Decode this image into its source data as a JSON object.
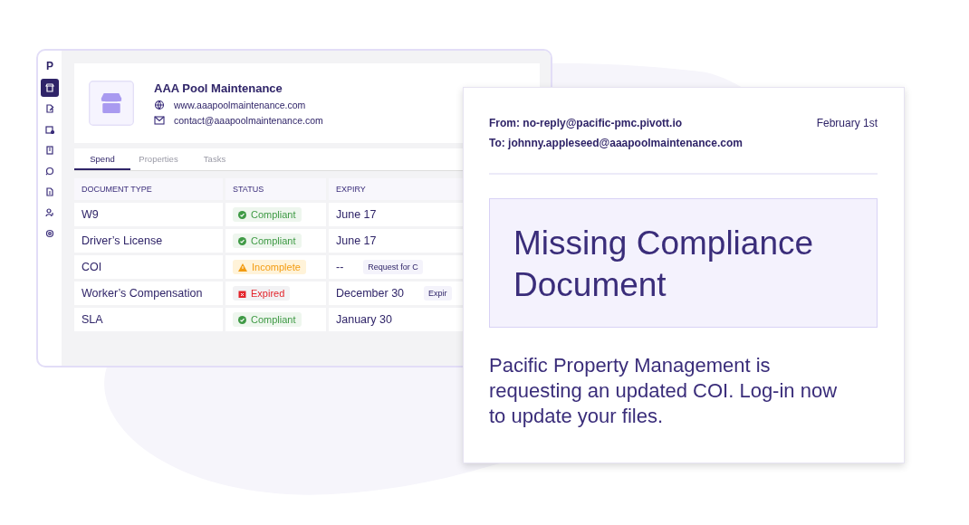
{
  "app": {
    "logo": "P",
    "sidebar": [
      {
        "selected": true
      },
      {
        "selected": false
      },
      {
        "selected": false
      },
      {
        "selected": false
      },
      {
        "selected": false
      },
      {
        "selected": false
      },
      {
        "selected": false
      },
      {
        "selected": false
      }
    ],
    "vendor": {
      "name": "AAA Pool Maintenance",
      "website": "www.aaapoolmaintenance.com",
      "email": "contact@aaapoolmaintenance.com"
    },
    "tabs": [
      {
        "label": "Spend",
        "selected": true
      },
      {
        "label": "Properties",
        "selected": false
      },
      {
        "label": "Tasks",
        "selected": false
      }
    ],
    "table": {
      "columns": [
        "DOCUMENT TYPE",
        "STATUS",
        "EXPIRY"
      ],
      "rows": [
        {
          "document_type": "W9",
          "status": "Compliant",
          "kind": "compliant",
          "expiry": "June 17"
        },
        {
          "document_type": "Driver’s License",
          "status": "Compliant",
          "kind": "compliant",
          "expiry": "June 17"
        },
        {
          "document_type": "COI",
          "status": "Incomplete",
          "kind": "incomplete",
          "expiry": "--",
          "action": "Request for C"
        },
        {
          "document_type": "Worker’s Compensation",
          "status": "Expired",
          "kind": "expired",
          "expiry": "December 30",
          "action": "Expir"
        },
        {
          "document_type": "SLA",
          "status": "Compliant",
          "kind": "compliant",
          "expiry": "January 30"
        }
      ]
    }
  },
  "email": {
    "from": "From: no-reply@pacific-pmc.pivott.io",
    "to": "To: johnny.appleseed@aaapoolmaintenance.com",
    "date": "February 1st",
    "heading": "Missing Compliance Document",
    "body": "Pacific Property Management is requesting an updated COI. Log-in now to update your files."
  }
}
